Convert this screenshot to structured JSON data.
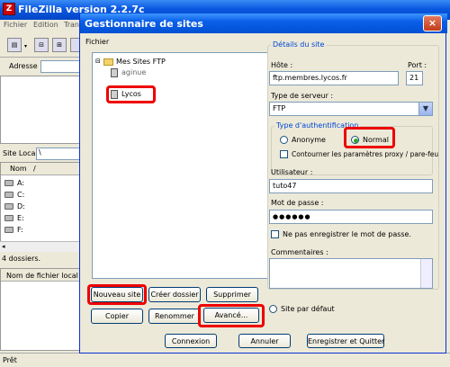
{
  "bg": {
    "title": "FileZilla version 2.2.7c",
    "menu": [
      "Fichier",
      "Edition",
      "Tran"
    ],
    "address_label": "Adresse :",
    "site_local_label": "Site Local :",
    "site_local_value": "\\",
    "col_name": "Nom",
    "col_sort": "/",
    "drives": [
      "A:",
      "C:",
      "D:",
      "E:",
      "F:"
    ],
    "dir_count": "4 dossiers.",
    "local_file_col": "Nom de fichier local",
    "status": "Prêt"
  },
  "dialog": {
    "title": "Gestionnaire de sites",
    "close": "×",
    "section_label": "Fichier",
    "tree": {
      "root": "Mes Sites FTP",
      "children": [
        "aginue",
        "Lycos"
      ]
    },
    "buttons": {
      "new_site": "Nouveau site",
      "new_folder": "Créer dossier",
      "delete": "Supprimer",
      "copy": "Copier",
      "rename": "Renommer",
      "advanced": "Avancé...",
      "connect": "Connexion",
      "cancel": "Annuler",
      "save_quit": "Enregistrer et Quitter"
    },
    "details": {
      "group_title": "Détails du site",
      "host_label": "Hôte :",
      "host_value": "ftp.membres.lycos.fr",
      "port_label": "Port :",
      "port_value": "21",
      "server_type_label": "Type de serveur :",
      "server_type_value": "FTP",
      "auth_group": "Type d'authentification",
      "auth_anon": "Anonyme",
      "auth_normal": "Normal",
      "bypass_proxy": "Contourner les paramètres proxy / pare-feu",
      "user_label": "Utilisateur :",
      "user_value": "tuto47",
      "password_label": "Mot de passe :",
      "password_value": "●●●●●●",
      "no_save_password": "Ne pas enregistrer le mot de passe.",
      "comments_label": "Commentaires :",
      "default_site": "Site par défaut"
    }
  },
  "colors": {
    "highlight": "#e00000",
    "titlebar": "#0a5fe8"
  }
}
